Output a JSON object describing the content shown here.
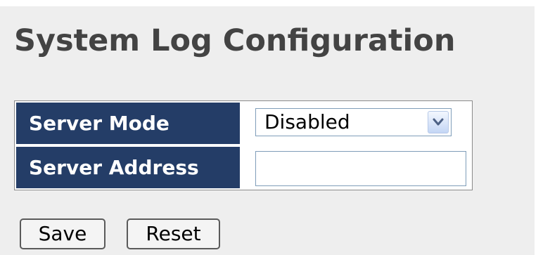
{
  "page": {
    "title": "System Log Configuration"
  },
  "config": {
    "server_mode": {
      "label": "Server Mode",
      "value": "Disabled",
      "arrow_icon": "chevron-down-icon"
    },
    "server_address": {
      "label": "Server Address",
      "value": "",
      "placeholder": ""
    }
  },
  "actions": {
    "save_label": "Save",
    "reset_label": "Reset"
  },
  "colors": {
    "header_cell_bg": "#243d67",
    "header_cell_text": "#ffffff",
    "title_text": "#434343",
    "page_bg": "#eeeeee"
  }
}
